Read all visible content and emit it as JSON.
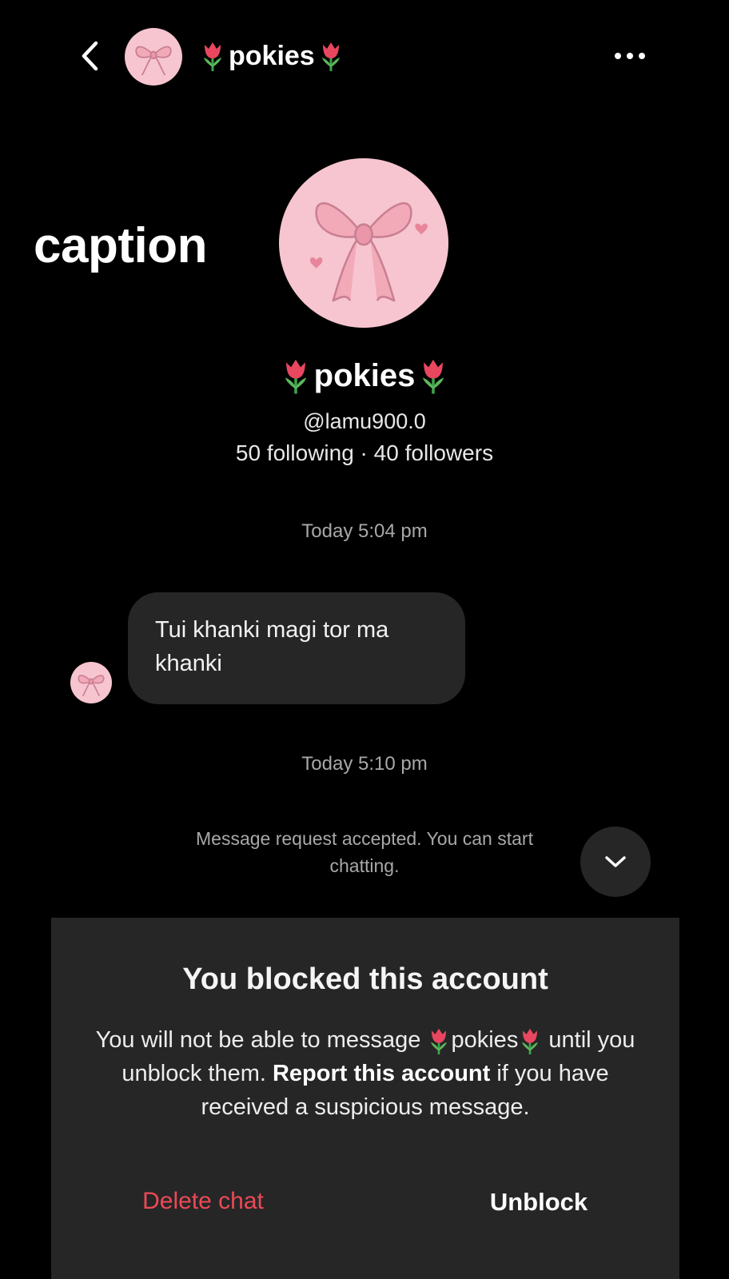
{
  "header": {
    "display_name": "pokies",
    "more_label": "More options"
  },
  "overlay": {
    "caption": "caption"
  },
  "profile": {
    "display_name": "pokies",
    "handle": "@lamu900.0",
    "stats": "50 following · 40 followers"
  },
  "thread": {
    "timestamp_1": "Today 5:04 pm",
    "message_1": "Tui khanki magi tor ma khanki",
    "timestamp_2": "Today 5:10 pm",
    "system_message": "Message request accepted. You can start chatting."
  },
  "blocked": {
    "title": "You blocked this account",
    "body_prefix": "You will not be able to message",
    "body_name": "pokies",
    "body_middle": "until you unblock them.",
    "report_link": "Report this account",
    "body_suffix": "if you have received a suspicious message.",
    "delete_label": "Delete chat",
    "unblock_label": "Unblock"
  },
  "colors": {
    "background": "#000000",
    "bubble": "#262626",
    "avatar_pink": "#f6c5cf",
    "danger": "#ed4956",
    "muted_text": "#a8a8a8"
  },
  "icons": [
    "chevron-left-icon",
    "tulip-icon",
    "bow-icon",
    "more-dots-icon",
    "chevron-down-icon"
  ]
}
